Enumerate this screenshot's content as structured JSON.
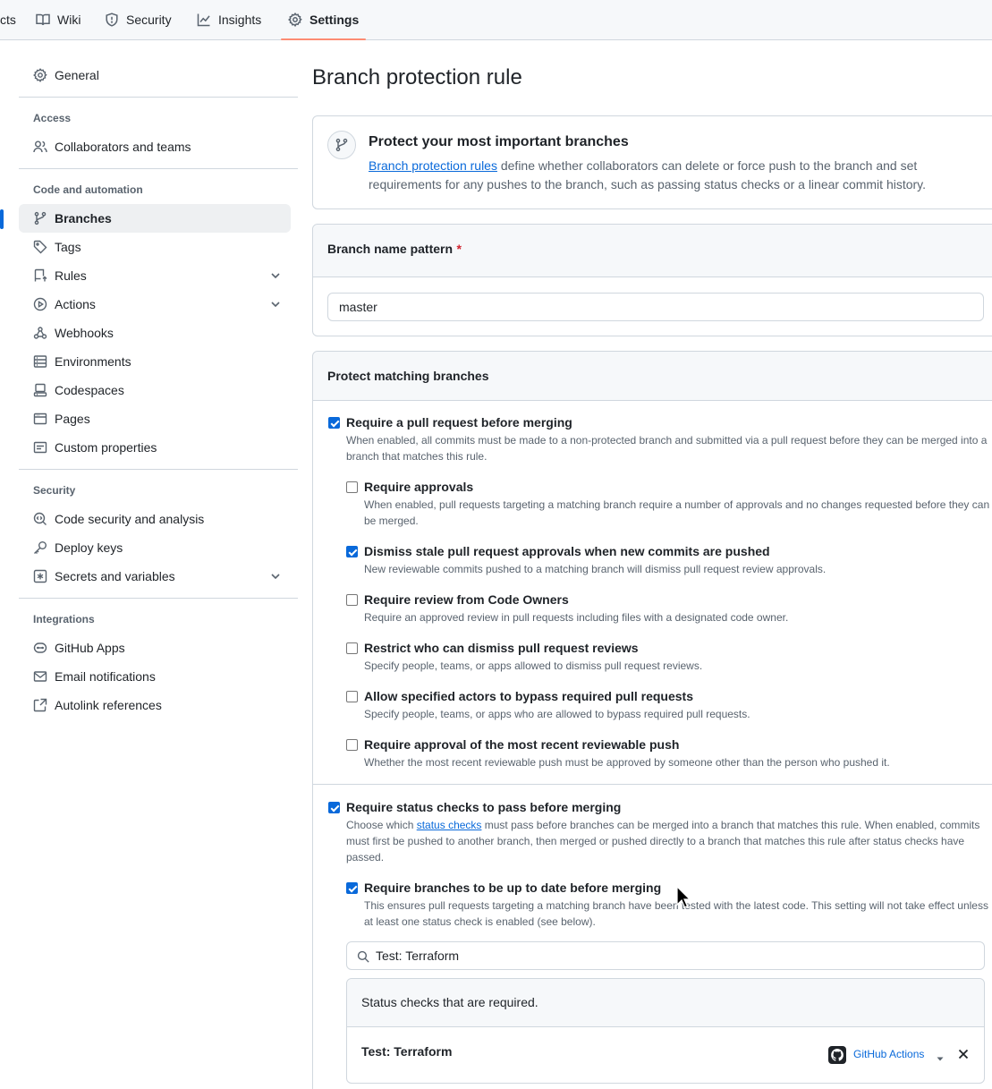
{
  "tabs": [
    {
      "label": "cts",
      "icon": "project-icon"
    },
    {
      "label": "Wiki",
      "icon": "book-icon"
    },
    {
      "label": "Security",
      "icon": "shield-icon"
    },
    {
      "label": "Insights",
      "icon": "graph-icon"
    },
    {
      "label": "Settings",
      "icon": "gear-icon",
      "selected": true
    }
  ],
  "sidebar": {
    "general": "General",
    "access_heading": "Access",
    "collaborators": "Collaborators and teams",
    "code_heading": "Code and automation",
    "branches": "Branches",
    "tags": "Tags",
    "rules": "Rules",
    "actions": "Actions",
    "webhooks": "Webhooks",
    "environments": "Environments",
    "codespaces": "Codespaces",
    "pages": "Pages",
    "custom_properties": "Custom properties",
    "security_heading": "Security",
    "code_security": "Code security and analysis",
    "deploy_keys": "Deploy keys",
    "secrets": "Secrets and variables",
    "integrations_heading": "Integrations",
    "github_apps": "GitHub Apps",
    "email_notifications": "Email notifications",
    "autolink": "Autolink references"
  },
  "main": {
    "title": "Branch protection rule",
    "intro": {
      "title": "Protect your most important branches",
      "link_text": "Branch protection rules",
      "text": " define whether collaborators can delete or force push to the branch and set requirements for any pushes to the branch, such as passing status checks or a linear commit history."
    },
    "pattern": {
      "label": "Branch name pattern",
      "required_mark": "*",
      "value": "master"
    },
    "protect": {
      "heading": "Protect matching branches",
      "require_pr": {
        "title": "Require a pull request before merging",
        "desc": "When enabled, all commits must be made to a non-protected branch and submitted via a pull request before they can be merged into a branch that matches this rule.",
        "checked": true
      },
      "sub_options": [
        {
          "title": "Require approvals",
          "desc": "When enabled, pull requests targeting a matching branch require a number of approvals and no changes requested before they can be merged.",
          "checked": false
        },
        {
          "title": "Dismiss stale pull request approvals when new commits are pushed",
          "desc": "New reviewable commits pushed to a matching branch will dismiss pull request review approvals.",
          "checked": true
        },
        {
          "title": "Require review from Code Owners",
          "desc": "Require an approved review in pull requests including files with a designated code owner.",
          "checked": false
        },
        {
          "title": "Restrict who can dismiss pull request reviews",
          "desc": "Specify people, teams, or apps allowed to dismiss pull request reviews.",
          "checked": false
        },
        {
          "title": "Allow specified actors to bypass required pull requests",
          "desc": "Specify people, teams, or apps who are allowed to bypass required pull requests.",
          "checked": false
        },
        {
          "title": "Require approval of the most recent reviewable push",
          "desc": "Whether the most recent reviewable push must be approved by someone other than the person who pushed it.",
          "checked": false
        }
      ],
      "status_checks": {
        "title": "Require status checks to pass before merging",
        "desc_before": "Choose which ",
        "desc_link": "status checks",
        "desc_after": " must pass before branches can be merged into a branch that matches this rule. When enabled, commits must first be pushed to another branch, then merged or pushed directly to a branch that matches this rule after status checks have passed.",
        "checked": true
      },
      "up_to_date": {
        "title": "Require branches to be up to date before merging",
        "desc": "This ensures pull requests targeting a matching branch have been tested with the latest code. This setting will not take effect unless at least one status check is enabled (see below).",
        "checked": true
      },
      "search_value": "Test: Terraform",
      "required_header": "Status checks that are required.",
      "check": {
        "name": "Test: Terraform",
        "source": "GitHub Actions"
      }
    }
  },
  "colors": {
    "accent": "#0969da",
    "tab_underline": "#fd8c73",
    "required": "#d1242f"
  }
}
